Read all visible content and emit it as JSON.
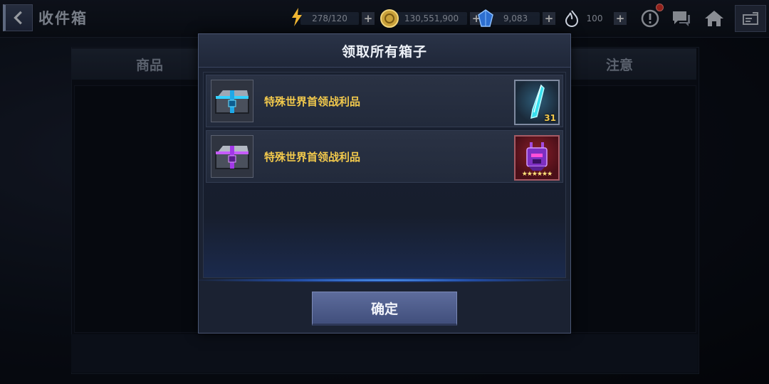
{
  "topbar": {
    "title": "收件箱",
    "back_icon": "chevron-left-icon",
    "energy": {
      "value": "278/120",
      "icon": "lightning-icon"
    },
    "gold": {
      "value": "130,551,900",
      "icon": "gold-coin-icon"
    },
    "crystal": {
      "value": "9,083",
      "icon": "blue-crystal-icon"
    },
    "flame": {
      "value": "100",
      "icon": "flame-icon"
    },
    "plus_symbol": "+",
    "icons": [
      "alert-icon",
      "chat-icon",
      "home-icon",
      "menu-icon"
    ]
  },
  "background_panel": {
    "tab_left": "商品",
    "tab_right": "注意"
  },
  "modal": {
    "title": "领取所有箱子",
    "items": [
      {
        "label": "特殊世界首领战利品",
        "chest": "blue-chest-icon",
        "reward": "crystal-shard-icon",
        "quantity": "31"
      },
      {
        "label": "特殊世界首领战利品",
        "chest": "purple-chest-icon",
        "reward": "robot-head-icon",
        "stars": "★★★★★★"
      }
    ],
    "confirm_label": "确定"
  },
  "colors": {
    "accent_gold": "#f2c94c",
    "button_blue": "#4f5d8c",
    "glow_blue": "#5aa8ff",
    "alert_red": "#e0342a"
  }
}
